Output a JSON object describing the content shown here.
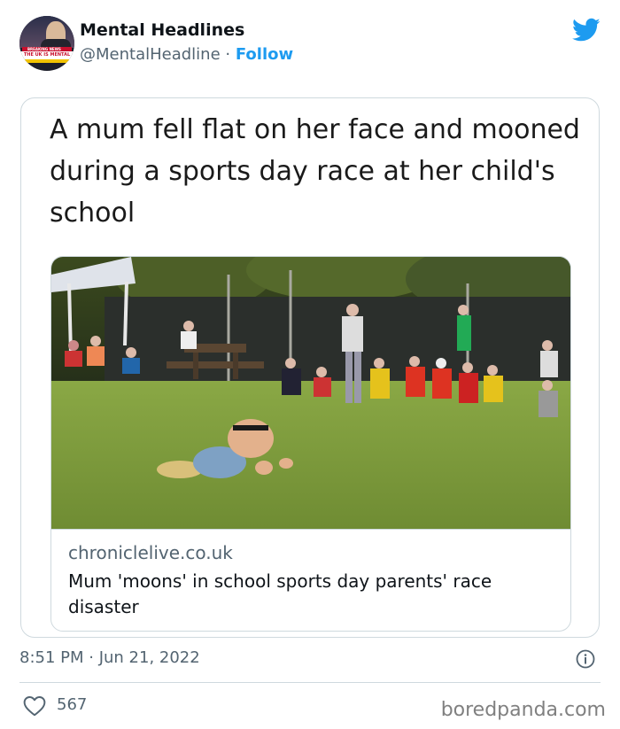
{
  "tweet": {
    "author": {
      "name": "Mental Headlines",
      "handle": "@MentalHeadline",
      "separator": "·",
      "follow_label": "Follow",
      "avatar_text": {
        "breaking": "BREAKING NEWS",
        "ticker": "THE UK IS MENTAL"
      }
    },
    "logo": "twitter-bird-icon",
    "image_headline": "A mum fell flat on her face and mooned during a sports day race at her child's school",
    "link_card": {
      "domain": "chroniclelive.co.uk",
      "title": "Mum 'moons' in school sports day parents' race disaster"
    },
    "timestamp": "8:51 PM · Jun 21, 2022",
    "likes": "567"
  },
  "watermark": "boredpanda.com",
  "colors": {
    "accent": "#1d9bf0",
    "secondary_text": "#536471",
    "border": "#cfd9de"
  }
}
